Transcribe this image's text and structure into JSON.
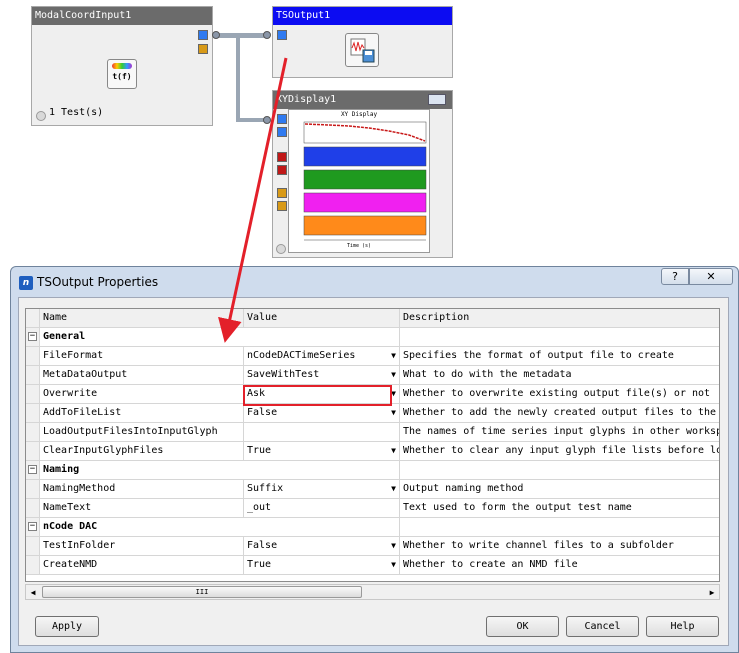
{
  "workspace": {
    "glyph1": {
      "title": "ModalCoordInput1",
      "function_icon_text": "t(f)",
      "status": "1 Test(s)"
    },
    "glyph2": {
      "title": "TSOutput1"
    },
    "glyph3": {
      "title": "XYDisplay1",
      "plot_title": "XY Display",
      "x_label": "Time (s)"
    }
  },
  "dialog": {
    "title": "TSOutput Properties",
    "icon_text": "n",
    "help_button": "?",
    "close_button": "✕",
    "headers": {
      "name": "Name",
      "value": "Value",
      "description": "Description"
    },
    "rows": [
      {
        "type": "category",
        "name": "General",
        "toggle": "−"
      },
      {
        "type": "prop",
        "name": "FileFormat",
        "value": "nCodeDACTimeSeries",
        "dropdown": true,
        "description": "Specifies the format of output file to create"
      },
      {
        "type": "prop",
        "name": "MetaDataOutput",
        "value": "SaveWithTest",
        "dropdown": true,
        "description": "What to do with the metadata"
      },
      {
        "type": "prop",
        "name": "Overwrite",
        "value": "Ask",
        "dropdown": true,
        "description": "Whether to overwrite existing output file(s) or not"
      },
      {
        "type": "prop",
        "name": "AddToFileList",
        "value": "False",
        "dropdown": true,
        "description": "Whether to add the newly created output files to the fil"
      },
      {
        "type": "prop",
        "name": "LoadOutputFilesIntoInputGlyph",
        "value": "",
        "dropdown": false,
        "description": "The names of time series input glyphs in other workspace"
      },
      {
        "type": "prop",
        "name": "ClearInputGlyphFiles",
        "value": "True",
        "dropdown": true,
        "description": "Whether to clear any input glyph file lists before loadi"
      },
      {
        "type": "category",
        "name": "Naming",
        "toggle": "−"
      },
      {
        "type": "prop",
        "name": "NamingMethod",
        "value": "Suffix",
        "dropdown": true,
        "description": "Output naming method"
      },
      {
        "type": "prop",
        "name": "NameText",
        "value": "_out",
        "dropdown": false,
        "description": "Text used to form the output test name"
      },
      {
        "type": "category",
        "name": "nCode DAC",
        "toggle": "−"
      },
      {
        "type": "prop",
        "name": "TestInFolder",
        "value": "False",
        "dropdown": true,
        "description": "Whether to write channel files to a subfolder"
      },
      {
        "type": "prop",
        "name": "CreateNMD",
        "value": "True",
        "dropdown": true,
        "description": "Whether to create an NMD file"
      }
    ],
    "scroll_thumb_grip": "III",
    "scroll_left": "◀",
    "scroll_right": "▶",
    "buttons": {
      "apply": "Apply",
      "ok": "OK",
      "cancel": "Cancel",
      "help": "Help"
    }
  },
  "colors": {
    "highlight": "#e3202a",
    "title_blue": "#0c0cf2"
  }
}
